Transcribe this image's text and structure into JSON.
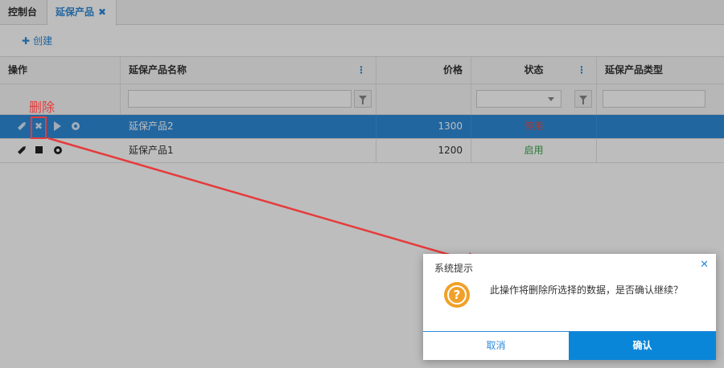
{
  "tabs": [
    {
      "label": "控制台"
    },
    {
      "label": "延保产品",
      "close": "✖"
    }
  ],
  "toolbar": {
    "create_icon": "✚",
    "create_label": "创建"
  },
  "table": {
    "columns": [
      {
        "label": "操作"
      },
      {
        "label": "延保产品名称",
        "menu": "⋮"
      },
      {
        "label": "价格"
      },
      {
        "label": "状态",
        "menu": "⋮"
      },
      {
        "label": "延保产品类型"
      }
    ],
    "rows": [
      {
        "name": "延保产品2",
        "price": "1300",
        "status": "停用",
        "type": ""
      },
      {
        "name": "延保产品1",
        "price": "1200",
        "status": "启用",
        "type": ""
      }
    ],
    "icons": [
      "pencil-icon",
      "delete-x-icon",
      "play-icon",
      "stop-icon",
      "gear-icon",
      "filter-icon",
      "chevron-down-icon"
    ]
  },
  "annotation": {
    "label": "删除",
    "color": "#e63b3b"
  },
  "dialog": {
    "title": "系统提示",
    "close": "✕",
    "icon": "?",
    "message": "此操作将删除所选择的数据，是否确认继续？",
    "cancel": "取消",
    "confirm": "确认"
  },
  "colors": {
    "accent": "#2e8ad8",
    "confirm": "#0a86d8",
    "warn": "#f0a12a",
    "disabled": "#d9534f",
    "enabled": "#3aa64a"
  }
}
